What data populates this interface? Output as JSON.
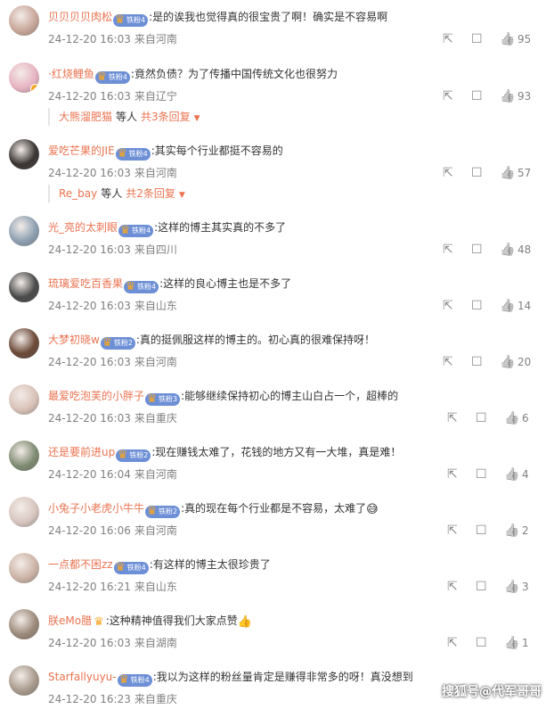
{
  "comments": [
    {
      "username": "贝贝贝贝肉松",
      "fan_badge": "铁粉4",
      "text": ":是的诶我也觉得真的很宝贵了啊！确实是不容易啊",
      "time": "24-12-20 16:03",
      "location": "来自河南",
      "likes": "95",
      "avatar_color": "#c9a79a"
    },
    {
      "username": "·红烧鲤鱼",
      "fan_badge": "铁粉4",
      "text": ":竟然负债？为了传播中国传统文化也很努力",
      "time": "24-12-20 16:03",
      "location": "来自辽宁",
      "likes": "93",
      "avatar_color": "#e8b4c3",
      "reply": {
        "name": "大熊溜肥猫",
        "middle": "等人",
        "total": "共3条回复",
        "arrow": "▼"
      }
    },
    {
      "username": "爱吃芒果的JIE",
      "fan_badge": "铁粉4",
      "text": ":其实每个行业都挺不容易的",
      "time": "24-12-20 16:03",
      "location": "来自河南",
      "likes": "57",
      "avatar_color": "#3a3533",
      "reply": {
        "name": "Re_bay",
        "middle": "等人",
        "total": "共2条回复",
        "arrow": "▼"
      }
    },
    {
      "username": "光_亮的太刺眼",
      "fan_badge": "铁粉4",
      "text": ":这样的博主其实真的不多了",
      "time": "24-12-20 16:03",
      "location": "来自四川",
      "likes": "48",
      "avatar_color": "#8ea0b2"
    },
    {
      "username": "琉璃爱吃百香果",
      "fan_badge": "铁粉4",
      "text": ":这样的良心博主也是不多了",
      "time": "24-12-20 16:03",
      "location": "来自山东",
      "likes": "14",
      "avatar_color": "#4a4a4a"
    },
    {
      "username": "大梦初晓w",
      "fan_badge": "铁粉2",
      "text": ":真的挺佩服这样的博主的。初心真的很难保持呀！",
      "time": "24-12-20 16:03",
      "location": "来自河南",
      "likes": "20",
      "avatar_color": "#6b4a38"
    },
    {
      "username": "最爱吃泡芙的小胖子",
      "fan_badge": "铁粉3",
      "text": ":能够继续保持初心的博主山白占一个，超棒的",
      "time": "24-12-20 16:03",
      "location": "来自重庆",
      "likes": "6",
      "avatar_color": "#d9c2b8"
    },
    {
      "username": "还是要前进up",
      "fan_badge": "铁粉2",
      "text": ":现在赚钱太难了，花钱的地方又有一大堆，真是难！",
      "time": "24-12-20 16:04",
      "location": "来自河南",
      "likes": "4",
      "avatar_color": "#7f8c72"
    },
    {
      "username": "小兔子小老虎小牛牛",
      "fan_badge": "铁粉2",
      "text": ":真的现在每个行业都是不容易，太难了",
      "emoji": "😅",
      "time": "24-12-20 16:06",
      "location": "来自河南",
      "likes": "2",
      "avatar_color": "#d8c6c0"
    },
    {
      "username": "一点都不困zz",
      "fan_badge": "铁粉4",
      "text": ":有这样的博主太很珍贵了",
      "time": "24-12-20 16:21",
      "location": "来自山东",
      "likes": "3",
      "avatar_color": "#cdb4a6"
    },
    {
      "username": "朕eMo腊",
      "text": ":这种精神值得我们大家点赞",
      "emoji": "👍",
      "time": "24-12-20 16:03",
      "location": "来自湖南",
      "likes": "1",
      "avatar_color": "#9c8a7a"
    },
    {
      "username": "Starfallyuyu-",
      "fan_badge": "铁粉4",
      "text": ":我以为这样的粉丝量肯定是赚得非常多的呀！真没想到",
      "time": "24-12-20 16:23",
      "location": "来自重庆",
      "avatar_color": "#a89a8c"
    }
  ],
  "icons": {
    "share": "share-icon",
    "comment": "comment-icon",
    "like": "like-icon",
    "crown": "crown-icon"
  },
  "colors": {
    "username": "#eb7350",
    "meta": "#808080",
    "text": "#333333"
  },
  "watermark": "搜狐号@代军哥哥"
}
